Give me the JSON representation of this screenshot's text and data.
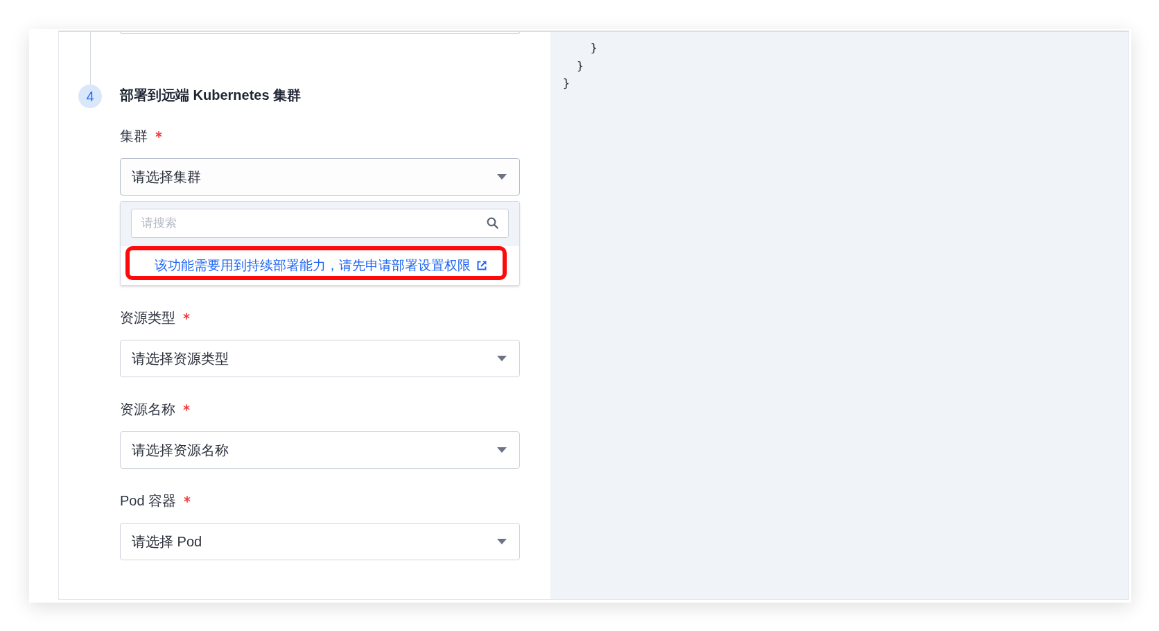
{
  "partial_field_above": true,
  "step": {
    "number": "4",
    "title": "部署到远端 Kubernetes 集群"
  },
  "fields": [
    {
      "label": "集群",
      "required": true,
      "placeholder": "请选择集群",
      "expanded": true,
      "dropdown": {
        "search_placeholder": "请搜索",
        "notice": {
          "text": "该功能需要用到持续部署能力，请先申请部署设置权限",
          "external_link": true,
          "highlighted": true
        }
      }
    },
    {
      "label": "资源类型",
      "required": true,
      "placeholder": "请选择资源类型",
      "expanded": false
    },
    {
      "label": "资源名称",
      "required": true,
      "placeholder": "请选择资源名称",
      "expanded": false
    },
    {
      "label": "Pod 容器",
      "required": true,
      "placeholder": "请选择 Pod",
      "expanded": false
    }
  ],
  "code_panel": {
    "lines": [
      "    }",
      "  }",
      "}"
    ]
  }
}
